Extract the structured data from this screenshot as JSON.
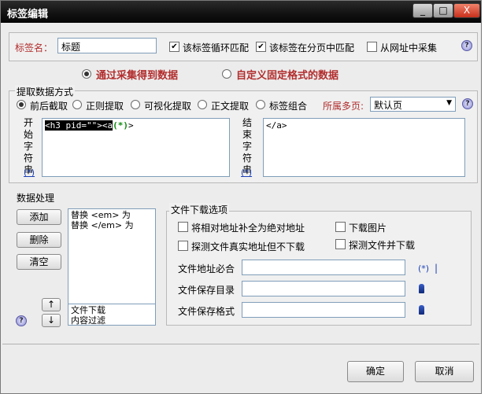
{
  "window": {
    "title": "标签编辑",
    "min_label": "_",
    "max_label": "□",
    "close_label": "X"
  },
  "tag": {
    "name_label": "标签名：",
    "name_value": "标题",
    "loop_match": "该标签循环匹配",
    "paging_match": "该标签在分页中匹配",
    "from_url": "从网址中采集",
    "loop_checked": true,
    "paging_checked": true,
    "from_url_checked": false
  },
  "mode": {
    "collect": "通过采集得到数据",
    "custom": "自定义固定格式的数据"
  },
  "extract": {
    "section_title": "提取数据方式",
    "options": [
      "前后截取",
      "正则提取",
      "可视化提取",
      "正文提取",
      "标签组合"
    ],
    "selected_index": 0,
    "multipage_label": "所属多页:",
    "multipage_value": "默认页",
    "start_label": "开始字符串",
    "end_label": "结束字符串",
    "start_prefix": "<h3 pid=\"\"><a",
    "start_token": "(*)",
    "start_suffix": ">",
    "end_value": "</a>",
    "wildcard": "(*)"
  },
  "processing": {
    "section_title": "数据处理",
    "add_button": "添加",
    "delete_button": "删除",
    "clear_button": "清空",
    "rules": [
      "替换 <em> 为",
      "替换 </em> 为"
    ],
    "bottom_items": [
      "文件下载",
      "内容过滤"
    ],
    "up_arrow": "↑",
    "down_arrow": "↓"
  },
  "download": {
    "section_title": "文件下载选项",
    "relative_to_absolute": "将相对地址补全为绝对地址",
    "download_images": "下载图片",
    "detect_real_no_download": "探测文件真实地址但不下载",
    "detect_and_download": "探测文件并下载",
    "must_contain_label": "文件地址必合",
    "save_dir_label": "文件保存目录",
    "save_format_label": "文件保存格式",
    "must_contain_value": "",
    "save_dir_value": "",
    "save_format_value": "",
    "wildcard": "(*)",
    "cursor": "|"
  },
  "footer": {
    "ok_button": "确定",
    "cancel_button": "取消"
  }
}
